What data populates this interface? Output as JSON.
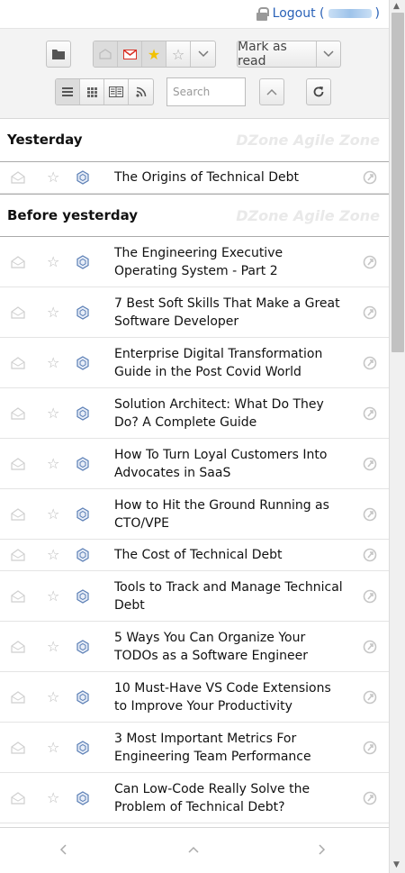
{
  "topbar": {
    "logout_label": "Logout (",
    "logout_suffix": ")"
  },
  "toolbar": {
    "mark_as_read_label": "Mark as read",
    "search_placeholder": "Search"
  },
  "sections": [
    {
      "title": "Yesterday",
      "source": "DZone Agile Zone",
      "items": [
        {
          "title": "The Origins of Technical Debt"
        }
      ]
    },
    {
      "title": "Before yesterday",
      "source": "DZone Agile Zone",
      "items": [
        {
          "title": "The Engineering Executive Operating System - Part 2"
        },
        {
          "title": "7 Best Soft Skills That Make a Great Software Developer"
        },
        {
          "title": "Enterprise Digital Transformation Guide in the Post Covid World"
        },
        {
          "title": "Solution Architect: What Do They Do? A Complete Guide"
        },
        {
          "title": "How To Turn Loyal Customers Into Advocates in SaaS"
        },
        {
          "title": "How to Hit the Ground Running as CTO/VPE"
        },
        {
          "title": "The Cost of Technical Debt"
        },
        {
          "title": "Tools to Track and Manage Technical Debt"
        },
        {
          "title": "5 Ways You Can Organize Your TODOs as a Software Engineer"
        },
        {
          "title": "10 Must-Have VS Code Extensions to Improve Your Productivity"
        },
        {
          "title": "3 Most Important Metrics For Engineering Team Performance"
        },
        {
          "title": "Can Low-Code Really Solve the Problem of Technical Debt?"
        }
      ]
    }
  ],
  "colors": {
    "link": "#2a62b8",
    "gmail_red": "#d93025",
    "star_yellow": "#f2c100",
    "feed_blue": "#5b7fb5"
  }
}
